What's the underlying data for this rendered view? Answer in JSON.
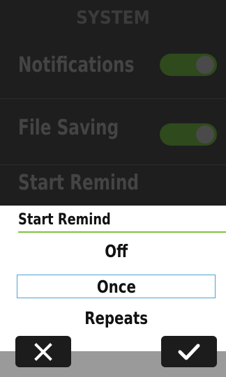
{
  "settings": {
    "header": "SYSTEM",
    "rows": [
      {
        "label": "Notifications",
        "toggle": "on"
      },
      {
        "label": "File Saving",
        "toggle": "on"
      },
      {
        "label": "Start Remind"
      }
    ]
  },
  "dialog": {
    "title": "Start Remind",
    "options": [
      "Off",
      "Once",
      "Repeats"
    ],
    "selected": "Once"
  },
  "buttons": {
    "cancel_icon": "close-icon",
    "confirm_icon": "check-icon"
  },
  "colors": {
    "accent": "#7ec23b",
    "selection": "#4ba3d6",
    "toggle_on": "#2f4a1c"
  }
}
